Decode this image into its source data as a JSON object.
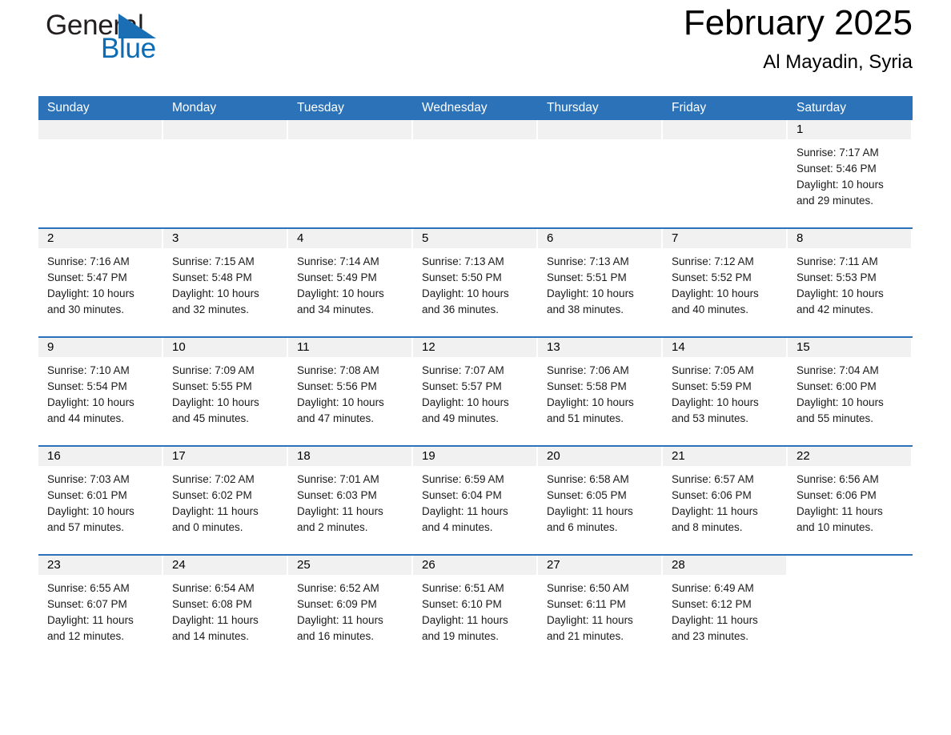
{
  "logo": {
    "word1": "General",
    "word2": "Blue",
    "triangle_color": "#1a6fb4",
    "word2_color": "#0b6cb5"
  },
  "header": {
    "month_title": "February 2025",
    "location": "Al Mayadin, Syria",
    "header_bg": "#2b72b8",
    "daynum_bg": "#f1f1f1"
  },
  "weekdays": [
    "Sunday",
    "Monday",
    "Tuesday",
    "Wednesday",
    "Thursday",
    "Friday",
    "Saturday"
  ],
  "labels": {
    "sunrise": "Sunrise:",
    "sunset": "Sunset:",
    "daylight": "Daylight:"
  },
  "weeks": [
    [
      {
        "day": "",
        "empty": true
      },
      {
        "day": "",
        "empty": true
      },
      {
        "day": "",
        "empty": true
      },
      {
        "day": "",
        "empty": true
      },
      {
        "day": "",
        "empty": true
      },
      {
        "day": "",
        "empty": true
      },
      {
        "day": "1",
        "sunrise": "Sunrise: 7:17 AM",
        "sunset": "Sunset: 5:46 PM",
        "daylight_l1": "Daylight: 10 hours",
        "daylight_l2": "and 29 minutes."
      }
    ],
    [
      {
        "day": "2",
        "sunrise": "Sunrise: 7:16 AM",
        "sunset": "Sunset: 5:47 PM",
        "daylight_l1": "Daylight: 10 hours",
        "daylight_l2": "and 30 minutes."
      },
      {
        "day": "3",
        "sunrise": "Sunrise: 7:15 AM",
        "sunset": "Sunset: 5:48 PM",
        "daylight_l1": "Daylight: 10 hours",
        "daylight_l2": "and 32 minutes."
      },
      {
        "day": "4",
        "sunrise": "Sunrise: 7:14 AM",
        "sunset": "Sunset: 5:49 PM",
        "daylight_l1": "Daylight: 10 hours",
        "daylight_l2": "and 34 minutes."
      },
      {
        "day": "5",
        "sunrise": "Sunrise: 7:13 AM",
        "sunset": "Sunset: 5:50 PM",
        "daylight_l1": "Daylight: 10 hours",
        "daylight_l2": "and 36 minutes."
      },
      {
        "day": "6",
        "sunrise": "Sunrise: 7:13 AM",
        "sunset": "Sunset: 5:51 PM",
        "daylight_l1": "Daylight: 10 hours",
        "daylight_l2": "and 38 minutes."
      },
      {
        "day": "7",
        "sunrise": "Sunrise: 7:12 AM",
        "sunset": "Sunset: 5:52 PM",
        "daylight_l1": "Daylight: 10 hours",
        "daylight_l2": "and 40 minutes."
      },
      {
        "day": "8",
        "sunrise": "Sunrise: 7:11 AM",
        "sunset": "Sunset: 5:53 PM",
        "daylight_l1": "Daylight: 10 hours",
        "daylight_l2": "and 42 minutes."
      }
    ],
    [
      {
        "day": "9",
        "sunrise": "Sunrise: 7:10 AM",
        "sunset": "Sunset: 5:54 PM",
        "daylight_l1": "Daylight: 10 hours",
        "daylight_l2": "and 44 minutes."
      },
      {
        "day": "10",
        "sunrise": "Sunrise: 7:09 AM",
        "sunset": "Sunset: 5:55 PM",
        "daylight_l1": "Daylight: 10 hours",
        "daylight_l2": "and 45 minutes."
      },
      {
        "day": "11",
        "sunrise": "Sunrise: 7:08 AM",
        "sunset": "Sunset: 5:56 PM",
        "daylight_l1": "Daylight: 10 hours",
        "daylight_l2": "and 47 minutes."
      },
      {
        "day": "12",
        "sunrise": "Sunrise: 7:07 AM",
        "sunset": "Sunset: 5:57 PM",
        "daylight_l1": "Daylight: 10 hours",
        "daylight_l2": "and 49 minutes."
      },
      {
        "day": "13",
        "sunrise": "Sunrise: 7:06 AM",
        "sunset": "Sunset: 5:58 PM",
        "daylight_l1": "Daylight: 10 hours",
        "daylight_l2": "and 51 minutes."
      },
      {
        "day": "14",
        "sunrise": "Sunrise: 7:05 AM",
        "sunset": "Sunset: 5:59 PM",
        "daylight_l1": "Daylight: 10 hours",
        "daylight_l2": "and 53 minutes."
      },
      {
        "day": "15",
        "sunrise": "Sunrise: 7:04 AM",
        "sunset": "Sunset: 6:00 PM",
        "daylight_l1": "Daylight: 10 hours",
        "daylight_l2": "and 55 minutes."
      }
    ],
    [
      {
        "day": "16",
        "sunrise": "Sunrise: 7:03 AM",
        "sunset": "Sunset: 6:01 PM",
        "daylight_l1": "Daylight: 10 hours",
        "daylight_l2": "and 57 minutes."
      },
      {
        "day": "17",
        "sunrise": "Sunrise: 7:02 AM",
        "sunset": "Sunset: 6:02 PM",
        "daylight_l1": "Daylight: 11 hours",
        "daylight_l2": "and 0 minutes."
      },
      {
        "day": "18",
        "sunrise": "Sunrise: 7:01 AM",
        "sunset": "Sunset: 6:03 PM",
        "daylight_l1": "Daylight: 11 hours",
        "daylight_l2": "and 2 minutes."
      },
      {
        "day": "19",
        "sunrise": "Sunrise: 6:59 AM",
        "sunset": "Sunset: 6:04 PM",
        "daylight_l1": "Daylight: 11 hours",
        "daylight_l2": "and 4 minutes."
      },
      {
        "day": "20",
        "sunrise": "Sunrise: 6:58 AM",
        "sunset": "Sunset: 6:05 PM",
        "daylight_l1": "Daylight: 11 hours",
        "daylight_l2": "and 6 minutes."
      },
      {
        "day": "21",
        "sunrise": "Sunrise: 6:57 AM",
        "sunset": "Sunset: 6:06 PM",
        "daylight_l1": "Daylight: 11 hours",
        "daylight_l2": "and 8 minutes."
      },
      {
        "day": "22",
        "sunrise": "Sunrise: 6:56 AM",
        "sunset": "Sunset: 6:06 PM",
        "daylight_l1": "Daylight: 11 hours",
        "daylight_l2": "and 10 minutes."
      }
    ],
    [
      {
        "day": "23",
        "sunrise": "Sunrise: 6:55 AM",
        "sunset": "Sunset: 6:07 PM",
        "daylight_l1": "Daylight: 11 hours",
        "daylight_l2": "and 12 minutes."
      },
      {
        "day": "24",
        "sunrise": "Sunrise: 6:54 AM",
        "sunset": "Sunset: 6:08 PM",
        "daylight_l1": "Daylight: 11 hours",
        "daylight_l2": "and 14 minutes."
      },
      {
        "day": "25",
        "sunrise": "Sunrise: 6:52 AM",
        "sunset": "Sunset: 6:09 PM",
        "daylight_l1": "Daylight: 11 hours",
        "daylight_l2": "and 16 minutes."
      },
      {
        "day": "26",
        "sunrise": "Sunrise: 6:51 AM",
        "sunset": "Sunset: 6:10 PM",
        "daylight_l1": "Daylight: 11 hours",
        "daylight_l2": "and 19 minutes."
      },
      {
        "day": "27",
        "sunrise": "Sunrise: 6:50 AM",
        "sunset": "Sunset: 6:11 PM",
        "daylight_l1": "Daylight: 11 hours",
        "daylight_l2": "and 21 minutes."
      },
      {
        "day": "28",
        "sunrise": "Sunrise: 6:49 AM",
        "sunset": "Sunset: 6:12 PM",
        "daylight_l1": "Daylight: 11 hours",
        "daylight_l2": "and 23 minutes."
      },
      {
        "day": "",
        "blank": true
      }
    ]
  ]
}
